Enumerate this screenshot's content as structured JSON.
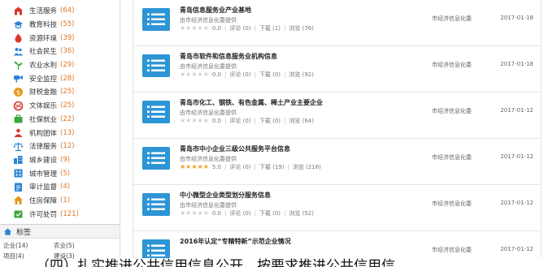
{
  "sidebar": {
    "categories": [
      {
        "label": "生活服务",
        "count": "(64)",
        "icon": "life-service-icon",
        "color": "#d9362b"
      },
      {
        "label": "教育科技",
        "count": "(55)",
        "icon": "education-icon",
        "color": "#2b84d6"
      },
      {
        "label": "资源环境",
        "count": "(39)",
        "icon": "resource-icon",
        "color": "#d9362b"
      },
      {
        "label": "社会民生",
        "count": "(36)",
        "icon": "society-icon",
        "color": "#2b84d6"
      },
      {
        "label": "农业水利",
        "count": "(29)",
        "icon": "agriculture-icon",
        "color": "#3aa83a"
      },
      {
        "label": "安全监控",
        "count": "(28)",
        "icon": "security-icon",
        "color": "#2b84d6"
      },
      {
        "label": "财税金融",
        "count": "(25)",
        "icon": "finance-icon",
        "color": "#e39a18"
      },
      {
        "label": "文体娱乐",
        "count": "(25)",
        "icon": "culture-icon",
        "color": "#d9362b"
      },
      {
        "label": "社保就业",
        "count": "(22)",
        "icon": "employment-icon",
        "color": "#3aa83a"
      },
      {
        "label": "机构团体",
        "count": "(13)",
        "icon": "organization-icon",
        "color": "#d9362b"
      },
      {
        "label": "法律服务",
        "count": "(12)",
        "icon": "law-icon",
        "color": "#2b84d6"
      },
      {
        "label": "城乡建设",
        "count": "(9)",
        "icon": "construction-icon",
        "color": "#2b84d6"
      },
      {
        "label": "城市管理",
        "count": "(5)",
        "icon": "city-icon",
        "color": "#2b84d6"
      },
      {
        "label": "审计监督",
        "count": "(4)",
        "icon": "audit-icon",
        "color": "#2b84d6"
      },
      {
        "label": "住房保障",
        "count": "(1)",
        "icon": "housing-icon",
        "color": "#e39a18"
      },
      {
        "label": "许可处罚",
        "count": "(121)",
        "icon": "license-icon",
        "color": "#3aa83a"
      }
    ],
    "tags": {
      "title": "标签",
      "icon": "home-icon",
      "items": [
        "企业(14)",
        "农业(5)",
        "项目(4)",
        "建设(3)"
      ]
    }
  },
  "list": [
    {
      "title": "青岛信息服务业产业基地",
      "source": "由市经济信息化委提供",
      "rating": "0.0",
      "stars": 0,
      "comments": "评论 (0)",
      "downloads": "下载 (1)",
      "views": "浏览 (76)",
      "provider": "市经济信息化委",
      "date": "2017-01-18"
    },
    {
      "title": "青岛市软件和信息服务业机构信息",
      "source": "由市经济信息化委提供",
      "rating": "0.0",
      "stars": 0,
      "comments": "评论 (0)",
      "downloads": "下载 (0)",
      "views": "浏览 (92)",
      "provider": "市经济信息化委",
      "date": "2017-01-18"
    },
    {
      "title": "青岛市化工、钢铁、有色金属、稀土产业主要企业",
      "source": "由市经济信息化委提供",
      "rating": "0.0",
      "stars": 0,
      "comments": "评论 (0)",
      "downloads": "下载 (0)",
      "views": "浏览 (64)",
      "provider": "市经济信息化委",
      "date": "2017-01-12"
    },
    {
      "title": "青岛市中小企业三级公共服务平台信息",
      "source": "由市经济信息化委提供",
      "rating": "5.0",
      "stars": 5,
      "comments": "评论 (0)",
      "downloads": "下载 (19)",
      "views": "浏览 (216)",
      "provider": "市经济信息化委",
      "date": "2017-01-12"
    },
    {
      "title": "中小微型企业类型划分服务信息",
      "source": "由市经济信息化委提供",
      "rating": "0.0",
      "stars": 0,
      "comments": "评论 (0)",
      "downloads": "下载 (0)",
      "views": "浏览 (52)",
      "provider": "市经济信息化委",
      "date": "2017-01-12"
    },
    {
      "title": "2016年认定“专精特新”示范企业情况",
      "source": "",
      "rating": "",
      "stars": 0,
      "comments": "",
      "downloads": "",
      "views": "",
      "provider": "市经济信息化委",
      "date": "2017-01-12"
    }
  ],
  "bottom_heading": "（四）扎实推进公共信用信息公开，按要求推进公共信用信",
  "colors": {
    "accent": "#2d95d5",
    "count": "#e07828",
    "star_on": "#f2a01e",
    "star_off": "#cfcfcf"
  }
}
